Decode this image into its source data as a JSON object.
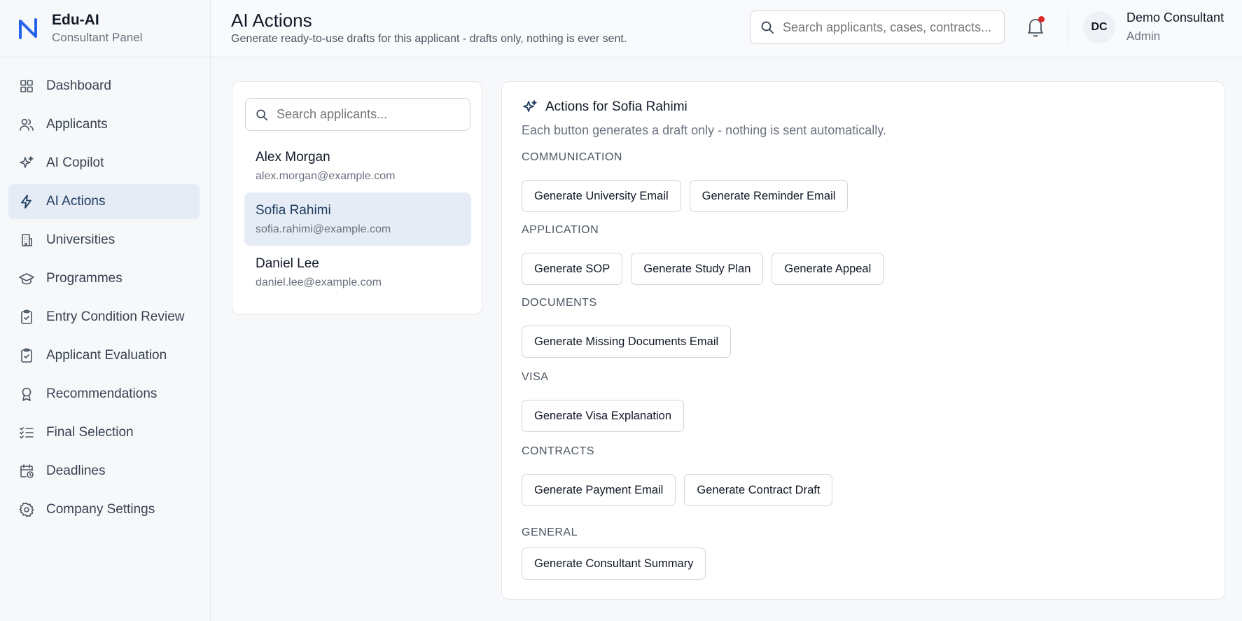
{
  "brand": {
    "name": "Edu-AI",
    "subtitle": "Consultant Panel"
  },
  "sidebar": {
    "items": [
      {
        "label": "Dashboard",
        "icon": "grid-icon",
        "active": false
      },
      {
        "label": "Applicants",
        "icon": "users-icon",
        "active": false
      },
      {
        "label": "AI Copilot",
        "icon": "sparkle-icon",
        "active": false
      },
      {
        "label": "AI Actions",
        "icon": "bolt-icon",
        "active": true
      },
      {
        "label": "Universities",
        "icon": "building-icon",
        "active": false
      },
      {
        "label": "Programmes",
        "icon": "graduation-cap-icon",
        "active": false
      },
      {
        "label": "Entry Condition Review",
        "icon": "clipboard-check-icon",
        "active": false
      },
      {
        "label": "Applicant Evaluation",
        "icon": "clipboard-check-icon",
        "active": false
      },
      {
        "label": "Recommendations",
        "icon": "award-icon",
        "active": false
      },
      {
        "label": "Final Selection",
        "icon": "list-check-icon",
        "active": false
      },
      {
        "label": "Deadlines",
        "icon": "calendar-clock-icon",
        "active": false
      },
      {
        "label": "Company Settings",
        "icon": "gear-icon",
        "active": false
      }
    ]
  },
  "header": {
    "title": "AI Actions",
    "subtitle": "Generate ready-to-use drafts for this applicant - drafts only, nothing is ever sent.",
    "search_placeholder": "Search applicants, cases, contracts...",
    "user": {
      "initials": "DC",
      "name": "Demo Consultant",
      "role": "Admin"
    }
  },
  "applicants": {
    "search_placeholder": "Search applicants...",
    "list": [
      {
        "name": "Alex Morgan",
        "email": "alex.morgan@example.com",
        "selected": false
      },
      {
        "name": "Sofia Rahimi",
        "email": "sofia.rahimi@example.com",
        "selected": true
      },
      {
        "name": "Daniel Lee",
        "email": "daniel.lee@example.com",
        "selected": false
      }
    ]
  },
  "actions": {
    "title": "Actions for Sofia Rahimi",
    "description": "Each button generates a draft only - nothing is sent automatically.",
    "sections": [
      {
        "label": "COMMUNICATION",
        "buttons": [
          "Generate University Email",
          "Generate Reminder Email"
        ]
      },
      {
        "label": "APPLICATION",
        "buttons": [
          "Generate SOP",
          "Generate Study Plan",
          "Generate Appeal"
        ]
      },
      {
        "label": "DOCUMENTS",
        "buttons": [
          "Generate Missing Documents Email"
        ]
      },
      {
        "label": "VISA",
        "buttons": [
          "Generate Visa Explanation"
        ]
      },
      {
        "label": "CONTRACTS",
        "buttons": [
          "Generate Payment Email",
          "Generate Contract Draft"
        ]
      },
      {
        "label": "GENERAL",
        "buttons": [
          "Generate Consultant Summary"
        ]
      }
    ]
  },
  "colors": {
    "accent": "#2563eb",
    "active_bg": "#e5ecf5",
    "notification_dot": "#dc2626"
  }
}
